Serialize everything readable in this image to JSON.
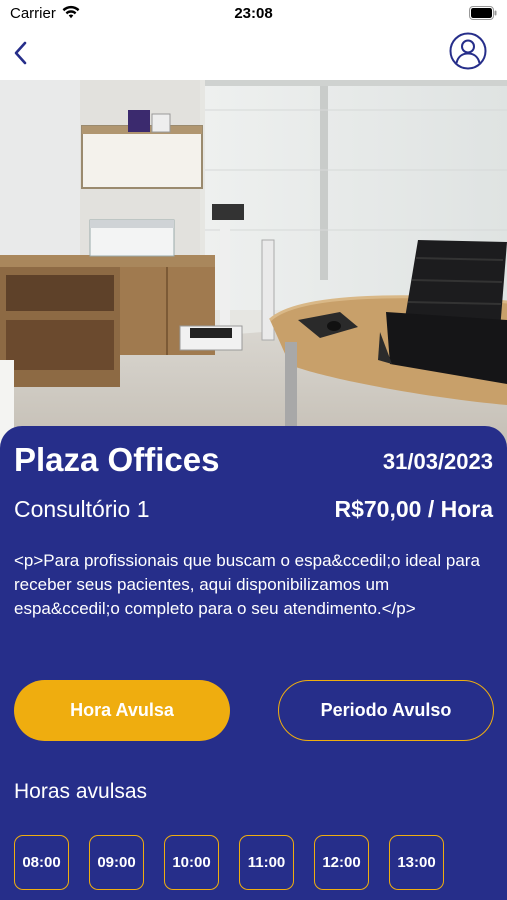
{
  "status_bar": {
    "carrier": "Carrier",
    "time": "23:08"
  },
  "nav": {
    "back_icon": "chevron-left-icon",
    "profile_icon": "user-circle-icon"
  },
  "hero": {
    "image": "office-room-photo"
  },
  "listing": {
    "title": "Plaza Offices",
    "date": "31/03/2023",
    "room": "Consultório 1",
    "price": "R$70,00 / Hora",
    "description": "<p>Para profissionais que buscam o espa&ccedil;o ideal para receber seus pacientes, aqui disponibilizamos um espa&ccedil;o completo para o seu atendimento.</p>"
  },
  "actions": {
    "primary_label": "Hora Avulsa",
    "secondary_label": "Periodo Avulso"
  },
  "slots_section": {
    "label": "Horas avulsas",
    "slots": [
      "08:00",
      "09:00",
      "10:00",
      "11:00",
      "12:00",
      "13:00"
    ]
  },
  "colors": {
    "card_background": "#262e8a",
    "accent": "#efad0f",
    "nav_icon": "#262e8a"
  }
}
